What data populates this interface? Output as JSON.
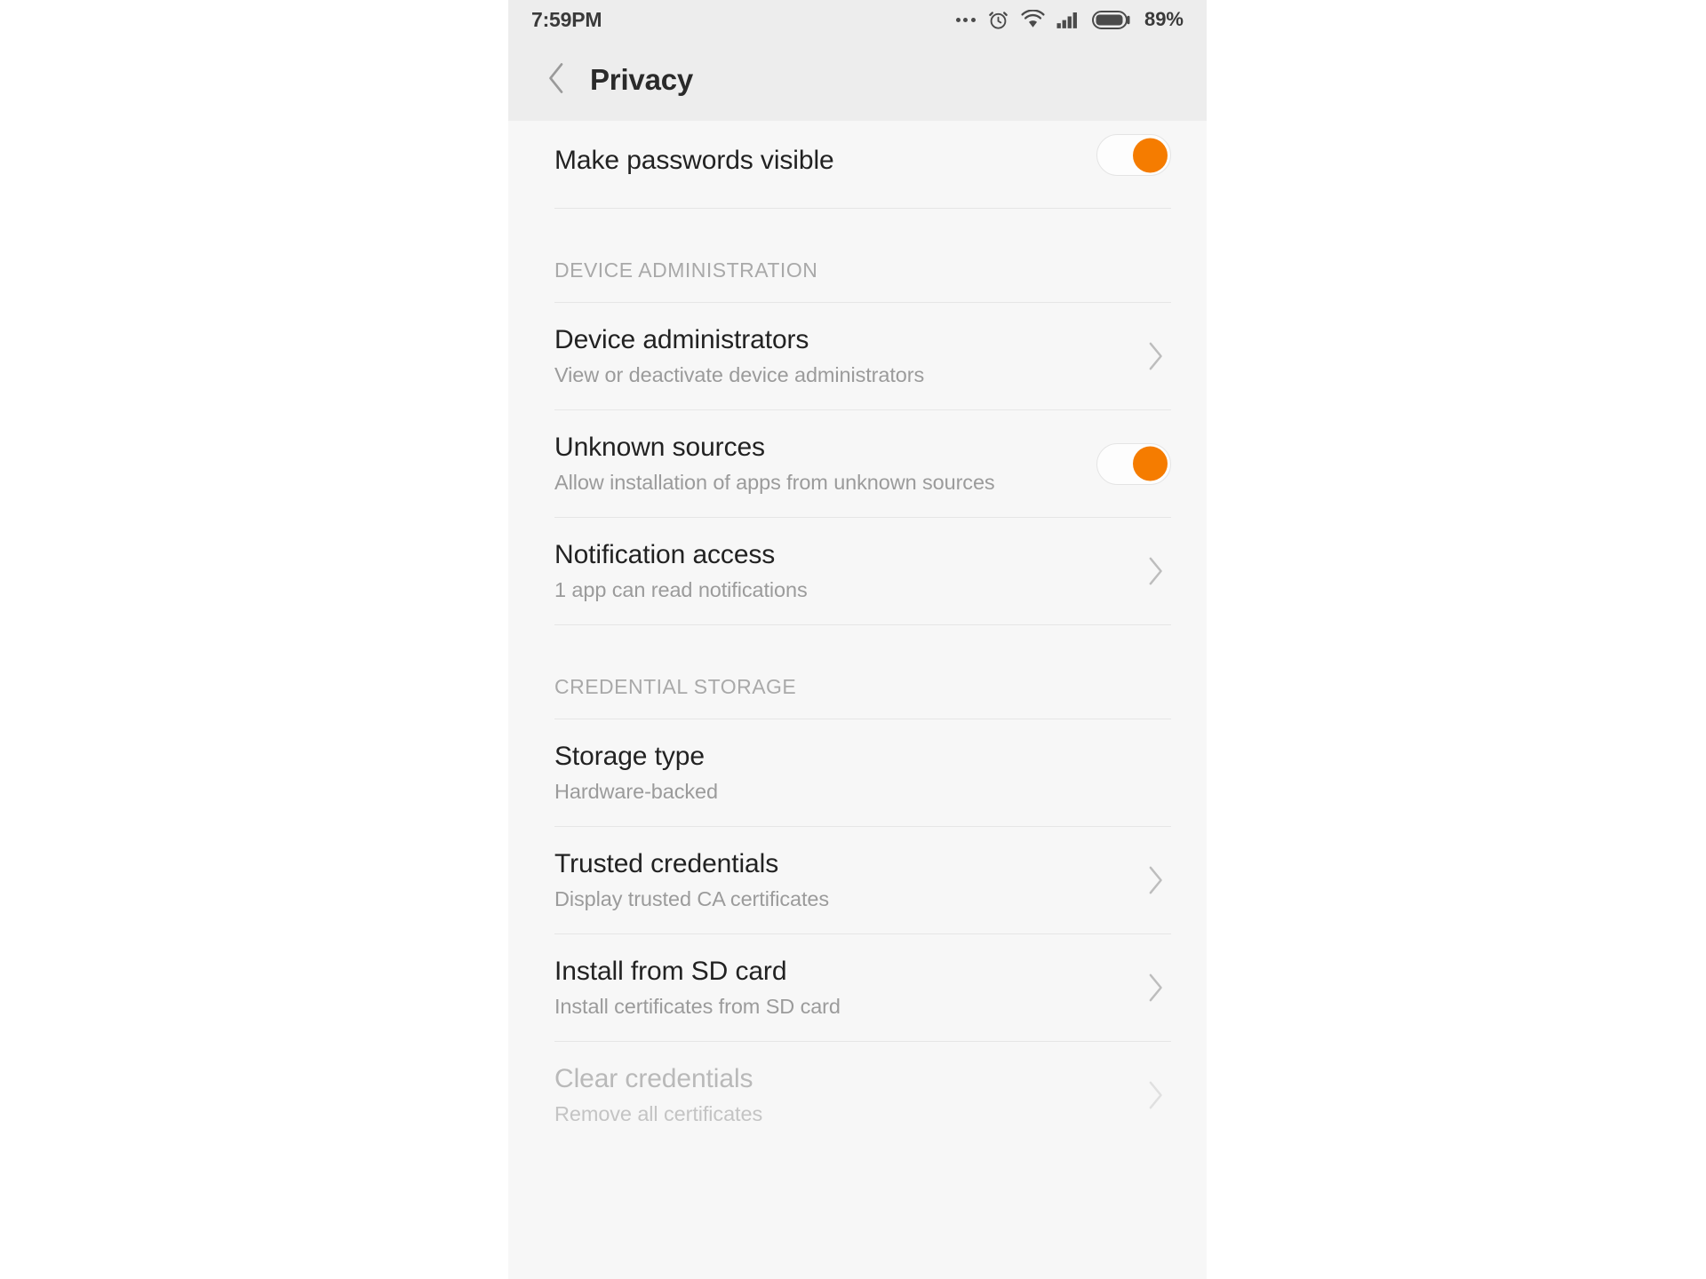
{
  "status_bar": {
    "time": "7:59PM",
    "battery_percent": "89%",
    "icons": [
      "more-dots-icon",
      "alarm-clock-icon",
      "wifi-icon",
      "signal-bars-icon",
      "battery-icon"
    ]
  },
  "header": {
    "back_icon": "back-chevron-icon",
    "title": "Privacy"
  },
  "colors": {
    "accent": "#f57c00",
    "header_bg": "#ededed",
    "content_bg": "#f7f7f7",
    "divider": "#e6e6e6",
    "title_text": "#222222",
    "subtitle_text": "#9b9b9b",
    "disabled_text": "#b9b9b9"
  },
  "rows": {
    "make_passwords_visible": {
      "title": "Make passwords visible",
      "toggle_state": "on"
    },
    "device_administrators": {
      "title": "Device administrators",
      "subtitle": "View or deactivate device administrators"
    },
    "unknown_sources": {
      "title": "Unknown sources",
      "subtitle": "Allow installation of apps from unknown sources",
      "toggle_state": "on"
    },
    "notification_access": {
      "title": "Notification access",
      "subtitle": "1 app can read notifications"
    },
    "storage_type": {
      "title": "Storage type",
      "subtitle": "Hardware-backed"
    },
    "trusted_credentials": {
      "title": "Trusted credentials",
      "subtitle": "Display trusted CA certificates"
    },
    "install_from_sd_card": {
      "title": "Install from SD card",
      "subtitle": "Install certificates from SD card"
    },
    "clear_credentials": {
      "title": "Clear credentials",
      "subtitle": "Remove all certificates"
    }
  },
  "sections": {
    "device_administration": "DEVICE ADMINISTRATION",
    "credential_storage": "CREDENTIAL STORAGE"
  }
}
